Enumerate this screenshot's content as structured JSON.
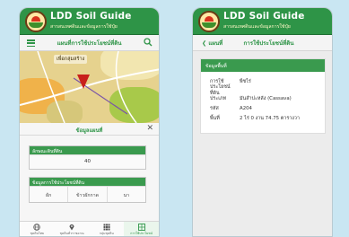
{
  "app": {
    "title": "LDD Soil Guide",
    "subtitle": "สารสนเทศดินและข้อมูลการใช้ปุ๋ย"
  },
  "screen1": {
    "header_title": "แผนที่การใช้ประโยชน์ที่ดิน",
    "map_label": "เพื่อกลุ่มสร้าง",
    "panel_title": "ข้อมูลแผนที่",
    "card1": {
      "heading": "ลักษณะดินที่ดิน",
      "value": "40"
    },
    "card2": {
      "heading": "ข้อมูลการใช้ประโยชน์ที่ดิน",
      "options": [
        "ผัก",
        "ข้าวผักกาด",
        "นา"
      ]
    },
    "nav": [
      {
        "label": "ชุดดินไทย",
        "icon": "globe-icon"
      },
      {
        "label": "ชุดดินทั่วราชอาณ",
        "icon": "location-icon"
      },
      {
        "label": "กลุ่มชุดดิน",
        "icon": "grid-icon"
      },
      {
        "label": "การใช้ประโยชน์",
        "icon": "map-icon"
      }
    ]
  },
  "screen2": {
    "back_label": "แผนที่",
    "header_title": "การใช้ประโยชน์ที่ดิน",
    "section_title": "ข้อมูลพื้นที่",
    "rows": [
      {
        "key": "การใช้ประโยชน์ที่ดิน",
        "value": "พืชไร่"
      },
      {
        "key": "ประเภท",
        "value": "มันสำปะหลัง (Cassava)"
      },
      {
        "key": "รหัส",
        "value": "A204"
      },
      {
        "key": "พื้นที่",
        "value": "2 ไร่ 0 งาน 74.75 ตารางวา"
      }
    ]
  },
  "colors": {
    "primary": "#2e9447",
    "background": "#c9e6f2"
  }
}
